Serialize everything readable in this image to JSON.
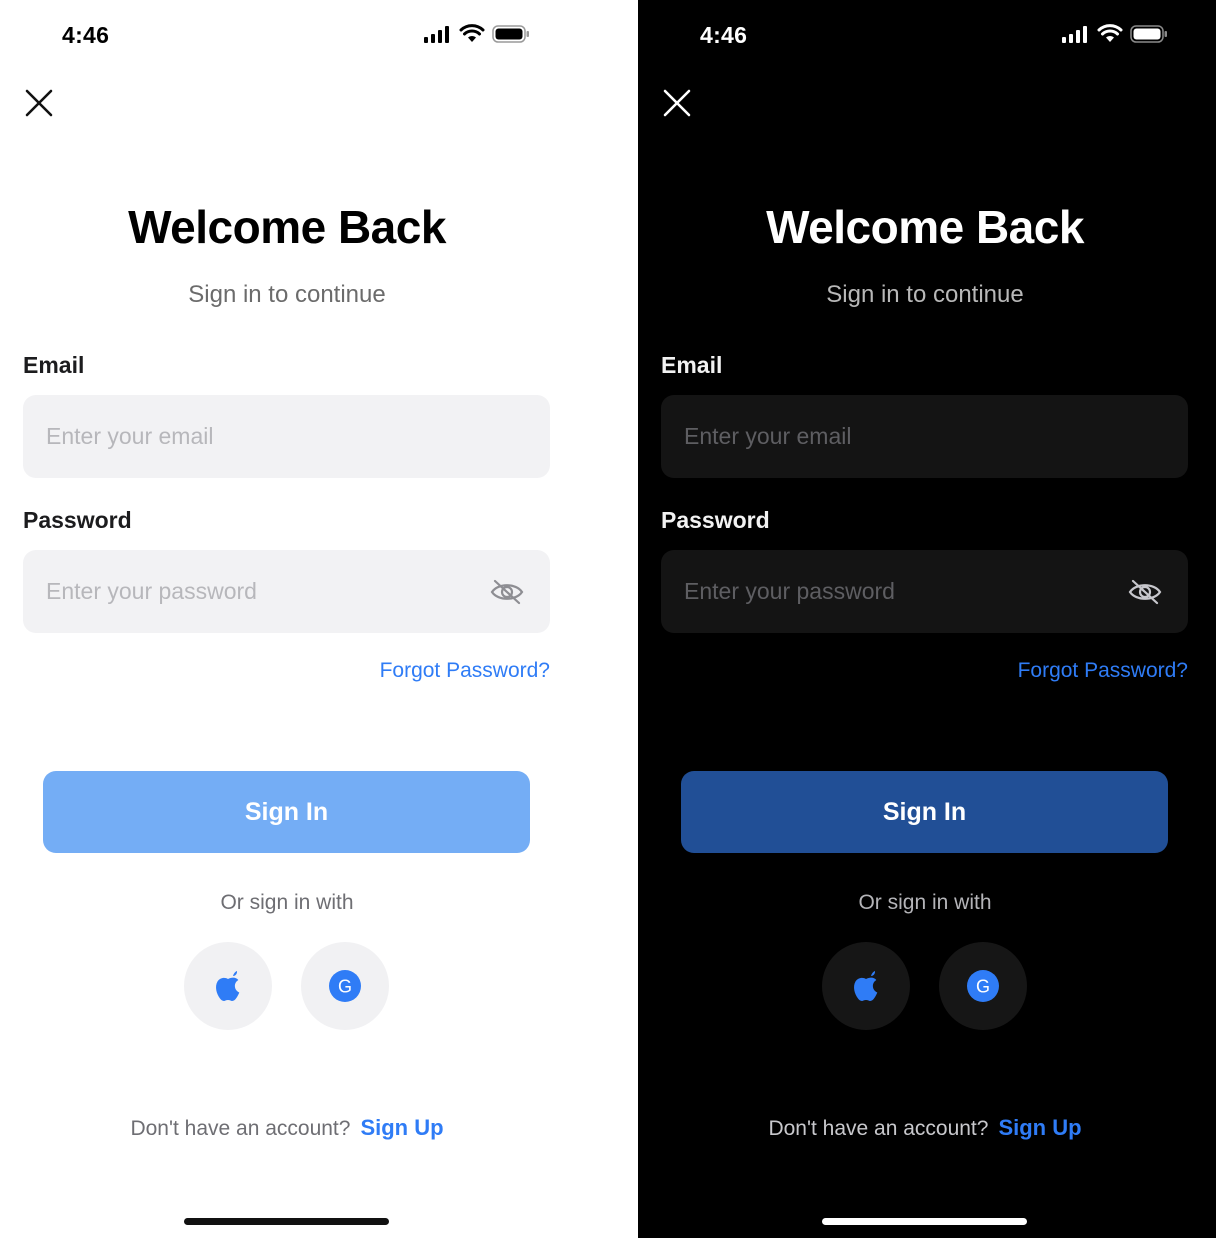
{
  "status_bar": {
    "time": "4:46"
  },
  "header": {
    "title": "Welcome Back",
    "subtitle": "Sign in to continue"
  },
  "form": {
    "email_label": "Email",
    "email_placeholder": "Enter your email",
    "email_value": "",
    "password_label": "Password",
    "password_placeholder": "Enter your password",
    "password_value": "",
    "forgot_label": "Forgot Password?",
    "signin_label": "Sign In"
  },
  "social": {
    "divider_text": "Or sign in with",
    "providers": [
      {
        "name": "Apple",
        "icon": "apple-icon"
      },
      {
        "name": "Google",
        "icon": "google-icon"
      }
    ]
  },
  "footer": {
    "prompt": "Don't have an account?",
    "signup_label": "Sign Up"
  },
  "colors": {
    "accent": "#2f7cf6",
    "signin_light": "#74adf5",
    "signin_dark": "#214f96",
    "light_bg": "#ffffff",
    "dark_bg": "#000000"
  },
  "themes": [
    "light",
    "dark"
  ]
}
